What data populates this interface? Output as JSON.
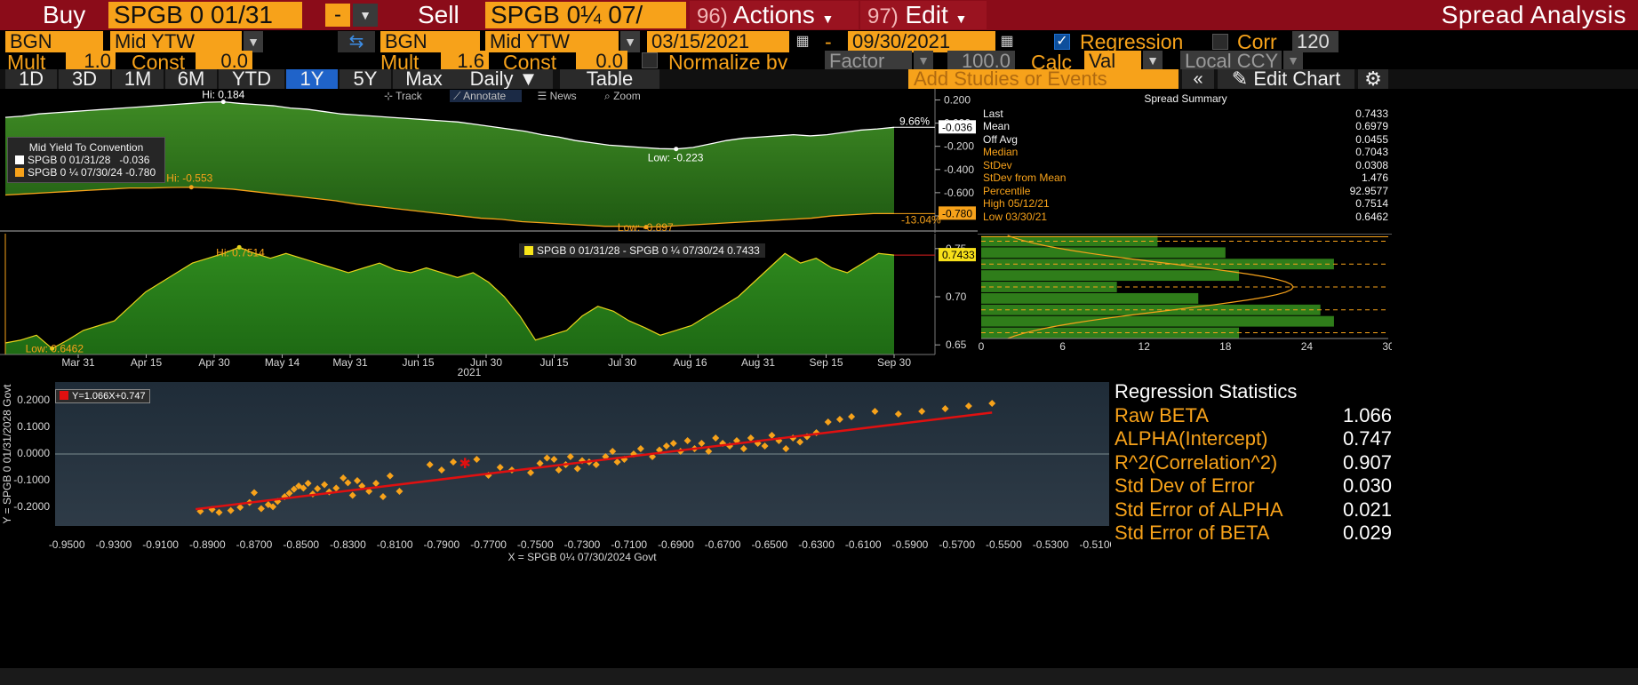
{
  "top": {
    "buy_label": "Buy",
    "buy_security": "SPGB 0 01/31",
    "minus": "-",
    "sell_label": "Sell",
    "sell_security": "SPGB 0¼ 07/",
    "actions_num": "96)",
    "actions_label": "Actions",
    "edit_num": "97)",
    "edit_label": "Edit",
    "title": "Spread Analysis"
  },
  "row1": {
    "left_source": "BGN",
    "left_field": "Mid YTW",
    "right_source": "BGN",
    "right_field": "Mid YTW",
    "start_date": "03/15/2021",
    "dash": "-",
    "end_date": "09/30/2021",
    "regression_label": "Regression",
    "corr_label": "Corr",
    "corr_value": "120"
  },
  "row2": {
    "mult_label": "Mult",
    "mult_left": "1.0",
    "const_label": "Const",
    "const_left": "0.0",
    "mult_right": "1.6",
    "const_right": "0.0",
    "normalize_label": "Normalize by",
    "normalize_value": "Factor",
    "normalize_num": "100.0",
    "calc_label": "Calc",
    "calc_value": "Val",
    "ccy_value": "Local CCY"
  },
  "tabs": [
    "1D",
    "3D",
    "1M",
    "6M",
    "YTD",
    "1Y",
    "5Y",
    "Max"
  ],
  "selected_tab": "1Y",
  "daily_label": "Daily ▼",
  "table_label": "Table",
  "add_studies": "Add Studies or Events",
  "edit_chart": "Edit Chart",
  "toolstrip": {
    "track": "Track",
    "annotate": "Annotate",
    "news": "News",
    "zoom": "Zoom"
  },
  "chart_data": [
    {
      "type": "area",
      "panel": "yields",
      "title": "",
      "legend_title": "Mid Yield To Convention",
      "series": [
        {
          "name": "SPGB 0 01/31/28",
          "last": "-0.036",
          "color": "#ffffff",
          "values": [
            0.05,
            0.06,
            0.08,
            0.09,
            0.1,
            0.11,
            0.12,
            0.13,
            0.14,
            0.15,
            0.16,
            0.17,
            0.18,
            0.184,
            0.17,
            0.16,
            0.15,
            0.13,
            0.12,
            0.1,
            0.08,
            0.07,
            0.06,
            0.05,
            0.04,
            0.03,
            0.02,
            0.01,
            -0.01,
            -0.03,
            -0.05,
            -0.07,
            -0.1,
            -0.12,
            -0.15,
            -0.17,
            -0.19,
            -0.2,
            -0.21,
            -0.22,
            -0.223,
            -0.21,
            -0.18,
            -0.15,
            -0.13,
            -0.12,
            -0.11,
            -0.1,
            -0.11,
            -0.1,
            -0.08,
            -0.06,
            -0.05,
            -0.036
          ]
        },
        {
          "name": "SPGB 0 ¼ 07/30/24",
          "last": "-0.780",
          "color": "#f7a21a",
          "values": [
            -0.62,
            -0.61,
            -0.6,
            -0.59,
            -0.58,
            -0.57,
            -0.56,
            -0.56,
            -0.555,
            -0.553,
            -0.56,
            -0.57,
            -0.59,
            -0.61,
            -0.63,
            -0.65,
            -0.67,
            -0.7,
            -0.72,
            -0.74,
            -0.76,
            -0.78,
            -0.8,
            -0.82,
            -0.83,
            -0.85,
            -0.86,
            -0.87,
            -0.88,
            -0.89,
            -0.89,
            -0.897,
            -0.89,
            -0.88,
            -0.87,
            -0.86,
            -0.85,
            -0.84,
            -0.83,
            -0.82,
            -0.8,
            -0.79,
            -0.78,
            -0.78
          ]
        }
      ],
      "ylim": [
        -0.9,
        0.25
      ],
      "yticks": [
        "0.200",
        "0.000",
        "-0.200",
        "-0.400",
        "-0.600",
        "-0.800"
      ],
      "annotations": {
        "hi_white": "Hi: 0.184",
        "low_white": "Low: -0.223",
        "hi_orange": "Hi: -0.553",
        "low_orange": "Low: -0.897",
        "pct_white": "9.66%",
        "pct_orange": "-13.04%"
      },
      "tag_white": "-0.036",
      "tag_orange": "-0.780"
    },
    {
      "type": "area",
      "panel": "spread",
      "legend": "SPGB 0 01/31/28 - SPGB 0 ¼ 07/30/24 0.7433",
      "series": [
        {
          "name": "SPGB 0 01/31/28 - SPGB 0 ¼ 07/30/24",
          "color": "#f7a21a",
          "values": [
            0.652,
            0.655,
            0.66,
            0.6462,
            0.655,
            0.665,
            0.67,
            0.675,
            0.69,
            0.705,
            0.715,
            0.725,
            0.735,
            0.74,
            0.745,
            0.7514,
            0.745,
            0.74,
            0.745,
            0.74,
            0.735,
            0.73,
            0.725,
            0.73,
            0.735,
            0.728,
            0.725,
            0.73,
            0.725,
            0.72,
            0.725,
            0.715,
            0.7,
            0.68,
            0.655,
            0.66,
            0.665,
            0.68,
            0.69,
            0.685,
            0.675,
            0.668,
            0.66,
            0.665,
            0.67,
            0.68,
            0.69,
            0.7,
            0.715,
            0.73,
            0.745,
            0.735,
            0.74,
            0.73,
            0.725,
            0.735,
            0.745,
            0.7433
          ]
        }
      ],
      "ylim": [
        0.64,
        0.76
      ],
      "yticks": [
        "0.75",
        "0.70",
        "0.65"
      ],
      "annotations": {
        "hi": "Hi: 0.7514",
        "low": "Low: 0.6462"
      },
      "tag": "0.7433",
      "xticks": [
        "Mar 31",
        "Apr 15",
        "Apr 30",
        "May 14",
        "May 31",
        "Jun 15",
        "Jun 30",
        "Jul 15",
        "Jul 30",
        "Aug 16",
        "Aug 31",
        "Sep 15",
        "Sep 30"
      ],
      "xyear": "2021"
    },
    {
      "type": "bar",
      "panel": "histogram",
      "orientation": "horizontal",
      "values": [
        13,
        18,
        26,
        19,
        10,
        16,
        25,
        26,
        19
      ],
      "xticks": [
        "0",
        "6",
        "12",
        "18",
        "24",
        "30"
      ],
      "xlim": [
        0,
        30
      ]
    },
    {
      "type": "scatter",
      "panel": "regression",
      "legend": "Y=1.066X+0.747",
      "xlabel": "X = SPGB 0¼ 07/30/2024 Govt",
      "ylabel": "Y = SPGB 0 01/31/2028 Govt",
      "xticks": [
        "-0.9500",
        "-0.9300",
        "-0.9100",
        "-0.8900",
        "-0.8700",
        "-0.8500",
        "-0.8300",
        "-0.8100",
        "-0.7900",
        "-0.7700",
        "-0.7500",
        "-0.7300",
        "-0.7100",
        "-0.6900",
        "-0.6700",
        "-0.6500",
        "-0.6300",
        "-0.6100",
        "-0.5900",
        "-0.5700",
        "-0.5500",
        "-0.5300",
        "-0.5100"
      ],
      "yticks": [
        "0.2000",
        "0.1000",
        "0.0000",
        "-0.1000",
        "-0.2000"
      ],
      "xlim": [
        -0.955,
        -0.505
      ],
      "ylim": [
        -0.27,
        0.27
      ],
      "fit": {
        "slope": 1.066,
        "intercept": 0.747,
        "x_from": -0.895,
        "x_to": -0.555
      },
      "current": [
        -0.78,
        -0.036
      ],
      "points": [
        [
          -0.893,
          -0.215
        ],
        [
          -0.888,
          -0.208
        ],
        [
          -0.885,
          -0.219
        ],
        [
          -0.88,
          -0.212
        ],
        [
          -0.876,
          -0.2
        ],
        [
          -0.872,
          -0.182
        ],
        [
          -0.87,
          -0.145
        ],
        [
          -0.867,
          -0.205
        ],
        [
          -0.864,
          -0.19
        ],
        [
          -0.862,
          -0.198
        ],
        [
          -0.86,
          -0.178
        ],
        [
          -0.857,
          -0.16
        ],
        [
          -0.855,
          -0.147
        ],
        [
          -0.853,
          -0.132
        ],
        [
          -0.851,
          -0.12
        ],
        [
          -0.849,
          -0.128
        ],
        [
          -0.847,
          -0.11
        ],
        [
          -0.845,
          -0.15
        ],
        [
          -0.843,
          -0.13
        ],
        [
          -0.84,
          -0.115
        ],
        [
          -0.838,
          -0.142
        ],
        [
          -0.835,
          -0.128
        ],
        [
          -0.832,
          -0.09
        ],
        [
          -0.83,
          -0.108
        ],
        [
          -0.828,
          -0.155
        ],
        [
          -0.826,
          -0.1
        ],
        [
          -0.824,
          -0.12
        ],
        [
          -0.821,
          -0.14
        ],
        [
          -0.818,
          -0.11
        ],
        [
          -0.815,
          -0.16
        ],
        [
          -0.812,
          -0.082
        ],
        [
          -0.808,
          -0.14
        ],
        [
          -0.795,
          -0.04
        ],
        [
          -0.79,
          -0.06
        ],
        [
          -0.785,
          -0.03
        ],
        [
          -0.775,
          -0.02
        ],
        [
          -0.77,
          -0.08
        ],
        [
          -0.765,
          -0.05
        ],
        [
          -0.76,
          -0.06
        ],
        [
          -0.752,
          -0.07
        ],
        [
          -0.748,
          -0.035
        ],
        [
          -0.745,
          -0.015
        ],
        [
          -0.742,
          -0.02
        ],
        [
          -0.74,
          -0.06
        ],
        [
          -0.737,
          -0.04
        ],
        [
          -0.735,
          -0.01
        ],
        [
          -0.732,
          -0.055
        ],
        [
          -0.73,
          -0.025
        ],
        [
          -0.727,
          -0.03
        ],
        [
          -0.724,
          -0.04
        ],
        [
          -0.72,
          -0.01
        ],
        [
          -0.717,
          0.01
        ],
        [
          -0.715,
          -0.03
        ],
        [
          -0.712,
          -0.02
        ],
        [
          -0.708,
          0.0
        ],
        [
          -0.705,
          0.02
        ],
        [
          -0.7,
          -0.01
        ],
        [
          -0.697,
          0.015
        ],
        [
          -0.694,
          0.03
        ],
        [
          -0.691,
          0.04
        ],
        [
          -0.688,
          0.01
        ],
        [
          -0.685,
          0.05
        ],
        [
          -0.682,
          0.02
        ],
        [
          -0.679,
          0.04
        ],
        [
          -0.676,
          0.01
        ],
        [
          -0.673,
          0.06
        ],
        [
          -0.67,
          0.04
        ],
        [
          -0.667,
          0.03
        ],
        [
          -0.664,
          0.05
        ],
        [
          -0.661,
          0.02
        ],
        [
          -0.658,
          0.06
        ],
        [
          -0.655,
          0.04
        ],
        [
          -0.652,
          0.03
        ],
        [
          -0.649,
          0.07
        ],
        [
          -0.646,
          0.05
        ],
        [
          -0.643,
          0.02
        ],
        [
          -0.64,
          0.06
        ],
        [
          -0.637,
          0.045
        ],
        [
          -0.634,
          0.065
        ],
        [
          -0.63,
          0.08
        ],
        [
          -0.625,
          0.12
        ],
        [
          -0.62,
          0.13
        ],
        [
          -0.615,
          0.14
        ],
        [
          -0.605,
          0.16
        ],
        [
          -0.595,
          0.15
        ],
        [
          -0.585,
          0.16
        ],
        [
          -0.575,
          0.17
        ],
        [
          -0.565,
          0.18
        ],
        [
          -0.555,
          0.19
        ]
      ]
    }
  ],
  "spread_summary": {
    "title": "Spread Summary",
    "rows": [
      {
        "label": "Last",
        "value": "0.7433",
        "color": "#f2f2f2"
      },
      {
        "label": "Mean",
        "value": "0.6979",
        "color": "#f2f2f2"
      },
      {
        "label": "Off Avg",
        "value": "0.0455",
        "color": "#f2f2f2"
      },
      {
        "label": "Median",
        "value": "0.7043",
        "color": "#f7a21a"
      },
      {
        "label": "StDev",
        "value": "0.0308",
        "color": "#f7a21a"
      },
      {
        "label": "StDev from Mean",
        "value": "1.476",
        "color": "#f7a21a"
      },
      {
        "label": "Percentile",
        "value": "92.9577",
        "color": "#f7a21a"
      },
      {
        "label": "High 05/12/21",
        "value": "0.7514",
        "color": "#f7a21a"
      },
      {
        "label": "Low 03/30/21",
        "value": "0.6462",
        "color": "#f7a21a"
      }
    ]
  },
  "regression_statistics": {
    "title": "Regression Statistics",
    "rows": [
      {
        "label": "Raw BETA",
        "value": "1.066"
      },
      {
        "label": "ALPHA(Intercept)",
        "value": "0.747"
      },
      {
        "label": "R^2(Correlation^2)",
        "value": "0.907"
      },
      {
        "label": "Std Dev of Error",
        "value": "0.030"
      },
      {
        "label": "Std Error of ALPHA",
        "value": "0.021"
      },
      {
        "label": "Std Error of BETA",
        "value": "0.029"
      }
    ]
  },
  "colors": {
    "accent": "#f7a21a",
    "header_red": "#8b0c19",
    "area_green": "#2e7d18",
    "selected_tab": "#1f63c9",
    "fit_line": "#e01010"
  }
}
